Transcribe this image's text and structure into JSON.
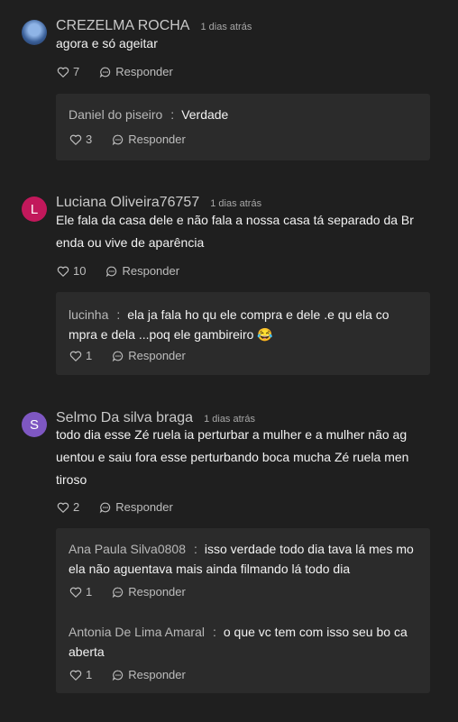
{
  "comments": [
    {
      "author": "CREZELMA ROCHA",
      "time": "1 dias atrás",
      "text": "agora e só ageitar",
      "likes": "7",
      "reply_label": "Responder",
      "replies": [
        {
          "author": "Daniel do piseiro",
          "text": "Verdade",
          "likes": "3",
          "reply_label": "Responder"
        }
      ]
    },
    {
      "avatar_letter": "L",
      "avatar_color": "#c2185b",
      "author": "Luciana Oliveira76757",
      "time": "1 dias atrás",
      "text": "Ele fala da casa dele e não fala a nossa casa tá separado da Br enda ou vive de aparência",
      "likes": "10",
      "reply_label": "Responder",
      "replies": [
        {
          "author": "lucinha",
          "text": "ela ja fala ho qu ele compra e dele .e qu ela co mpra e dela ...poq ele gambireiro 😂",
          "likes": "1",
          "reply_label": "Responder"
        }
      ]
    },
    {
      "avatar_letter": "S",
      "avatar_color": "#7e57c2",
      "author": "Selmo Da silva braga",
      "time": "1 dias atrás",
      "text": "todo dia esse Zé ruela ia perturbar a mulher e a mulher não ag uentou e saiu fora esse perturbando boca mucha Zé ruela men tiroso",
      "likes": "2",
      "reply_label": "Responder",
      "replies": [
        {
          "author": "Ana Paula Silva0808",
          "text": "isso verdade todo dia tava lá mes mo ela não aguentava mais ainda filmando lá todo dia",
          "likes": "1",
          "reply_label": "Responder"
        },
        {
          "author": "Antonia De Lima Amaral",
          "text": "o que vc tem com isso seu bo ca aberta",
          "likes": "1",
          "reply_label": "Responder"
        }
      ]
    }
  ]
}
